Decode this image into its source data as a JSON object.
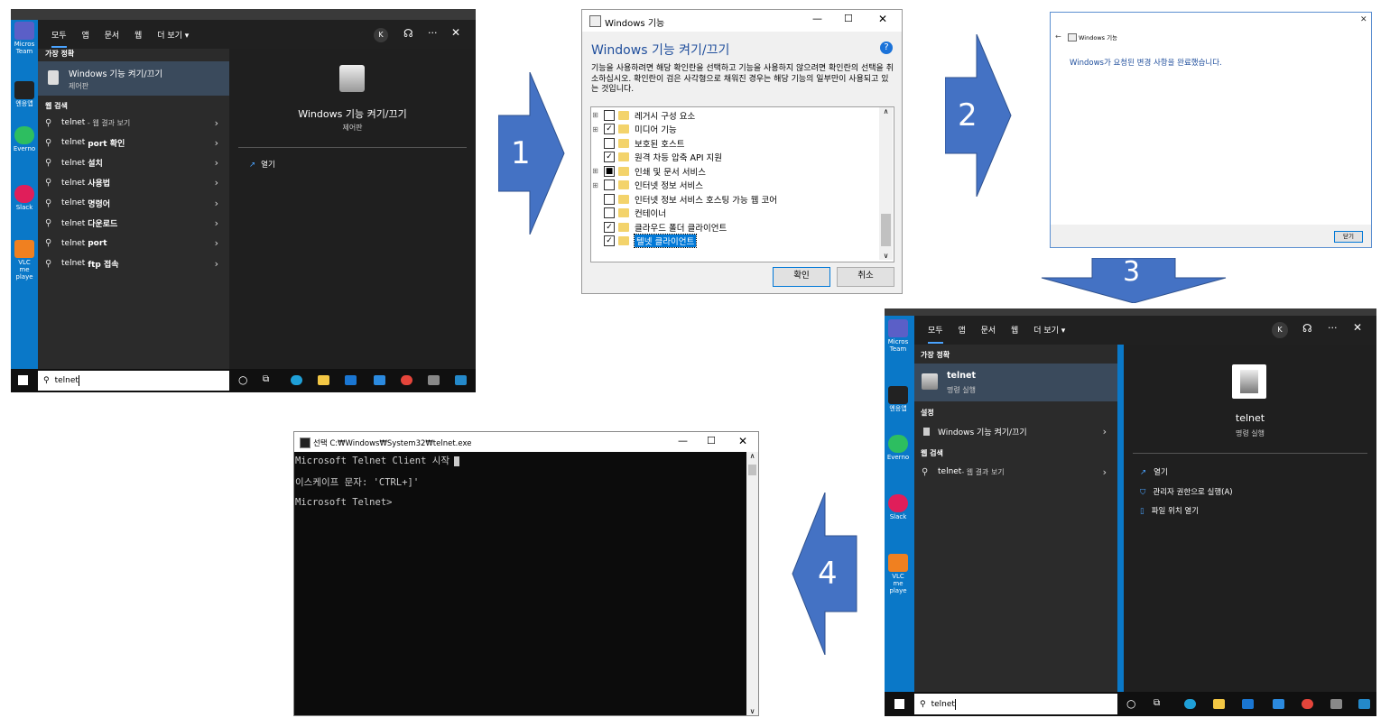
{
  "panel1": {
    "tabs": [
      "모두",
      "앱",
      "문서",
      "웹",
      "더 보기 ▾"
    ],
    "avatar": "K",
    "best_match_label": "가장 정확",
    "best_match_title": "Windows 기능 켜기/끄기",
    "best_match_sub": "제어판",
    "web_label": "웹 검색",
    "web_items": [
      {
        "pre": "telnet",
        "bold": "",
        "suffix": " - 웹 결과 보기"
      },
      {
        "pre": "telnet ",
        "bold": "port 확인",
        "suffix": ""
      },
      {
        "pre": "telnet ",
        "bold": "설치",
        "suffix": ""
      },
      {
        "pre": "telnet ",
        "bold": "사용법",
        "suffix": ""
      },
      {
        "pre": "telnet ",
        "bold": "명령어",
        "suffix": ""
      },
      {
        "pre": "telnet ",
        "bold": "다운로드",
        "suffix": ""
      },
      {
        "pre": "telnet ",
        "bold": "port",
        "suffix": ""
      },
      {
        "pre": "telnet ",
        "bold": "ftp 접속",
        "suffix": ""
      }
    ],
    "preview_title": "Windows 기능 켜기/끄기",
    "preview_sub": "제어판",
    "action_open": "열기",
    "search_value": "telnet",
    "desktop_icons": [
      "Micros Team",
      "엔응앱",
      "Everno",
      "Slack",
      "VLC me playe"
    ]
  },
  "features_dialog": {
    "title": "Windows 기능",
    "heading": "Windows 기능 켜기/끄기",
    "description": "기능을 사용하려면 해당 확인란을 선택하고 기능을 사용하지 않으려면 확인란의 선택을 취소하십시오. 확인란이 검은 사각형으로 채워진 경우는 해당 기능의 일부만이 사용되고 있는 것입니다.",
    "items": [
      {
        "label": "레거시 구성 요소",
        "state": "",
        "expand": "⊞"
      },
      {
        "label": "미디어 기능",
        "state": "✓",
        "expand": "⊞"
      },
      {
        "label": "보호된 호스트",
        "state": "",
        "expand": ""
      },
      {
        "label": "원격 차등 압축 API 지원",
        "state": "✓",
        "expand": ""
      },
      {
        "label": "인쇄 및 문서 서비스",
        "state": "■",
        "expand": "⊞"
      },
      {
        "label": "인터넷 정보 서비스",
        "state": "",
        "expand": "⊞"
      },
      {
        "label": "인터넷 정보 서비스 호스팅 가능 웹 코어",
        "state": "",
        "expand": ""
      },
      {
        "label": "컨테이너",
        "state": "",
        "expand": ""
      },
      {
        "label": "클라우드 폴더 클라이언트",
        "state": "✓",
        "expand": ""
      },
      {
        "label": "텔넷 클라이언트",
        "state": "✓",
        "expand": ""
      }
    ],
    "ok": "확인",
    "cancel": "취소"
  },
  "complete_dialog": {
    "title": "Windows 기능",
    "message": "Windows가 요청된 변경 사항을 완료했습니다.",
    "close_button": "닫기"
  },
  "panel3": {
    "tabs": [
      "모두",
      "앱",
      "문서",
      "웹",
      "더 보기 ▾"
    ],
    "avatar": "K",
    "best_match_label": "가장 정확",
    "best_match_title": "telnet",
    "best_match_sub": "명령 실행",
    "settings_label": "설정",
    "settings_item": "Windows 기능 켜기/끄기",
    "web_label": "웹 검색",
    "web_item_pre": "telnet",
    "web_item_suffix": " - 웹 결과 보기",
    "preview_title": "telnet",
    "preview_sub": "명령 실행",
    "actions": [
      "열기",
      "관리자 권한으로 실행(A)",
      "파일 위치 열기"
    ],
    "search_value": "telnet",
    "desktop_icons": [
      "Micros Team",
      "엔응앱",
      "Everno",
      "Slack",
      "VLC me playe"
    ]
  },
  "console": {
    "title": "선택 C:₩Windows₩System32₩telnet.exe",
    "lines": [
      "Microsoft Telnet Client 시작",
      "이스케이프 문자: 'CTRL+]'",
      "Microsoft Telnet>"
    ]
  },
  "arrows": [
    "1",
    "2",
    "3",
    "4"
  ],
  "colors": {
    "arrow_fill": "#4472c4",
    "arrow_stroke": "#2f528f",
    "desktop_blue": "#0a78c8",
    "link_blue": "#0066cc"
  }
}
